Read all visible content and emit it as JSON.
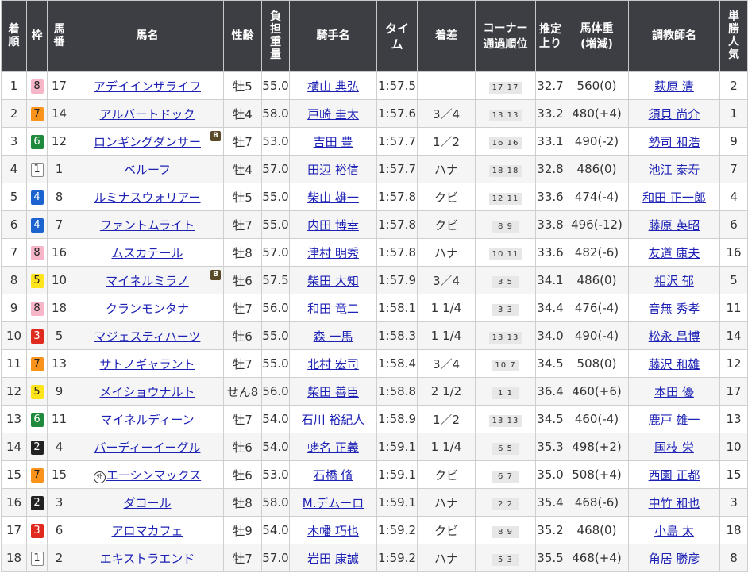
{
  "headers": {
    "rank": "着順",
    "waku": "枠",
    "umaban": "馬番",
    "horse": "馬名",
    "sexage": "性齢",
    "burden": "負担重量",
    "jockey": "騎手名",
    "time": "タイム",
    "margin": "着差",
    "corner": "コーナー通過順位",
    "agari": "推定上り",
    "weight": "馬体重(増減)",
    "trainer": "調教師名",
    "pop": "単勝人気"
  },
  "blinker_label": "B",
  "local_mark": "外",
  "rows": [
    {
      "rank": "1",
      "waku": "8",
      "umaban": "17",
      "horse": "アデイインザライフ",
      "blinker": false,
      "local": false,
      "sexage": "牡5",
      "burden": "55.0",
      "jockey": "横山 典弘",
      "time": "1:57.5",
      "margin": "",
      "corner": "17 17",
      "agari": "32.7",
      "weight": "560(0)",
      "trainer": "萩原 清",
      "pop": "2"
    },
    {
      "rank": "2",
      "waku": "7",
      "umaban": "14",
      "horse": "アルバートドック",
      "blinker": false,
      "local": false,
      "sexage": "牡4",
      "burden": "58.0",
      "jockey": "戸崎 圭太",
      "time": "1:57.6",
      "margin": "3／4",
      "corner": "13 13",
      "agari": "33.2",
      "weight": "480(+4)",
      "trainer": "須貝 尚介",
      "pop": "1"
    },
    {
      "rank": "3",
      "waku": "6",
      "umaban": "12",
      "horse": "ロンギングダンサー",
      "blinker": true,
      "local": false,
      "sexage": "牡7",
      "burden": "53.0",
      "jockey": "吉田 豊",
      "time": "1:57.7",
      "margin": "1／2",
      "corner": "16 16",
      "agari": "33.1",
      "weight": "490(-2)",
      "trainer": "勢司 和浩",
      "pop": "9"
    },
    {
      "rank": "4",
      "waku": "1",
      "umaban": "1",
      "horse": "ベルーフ",
      "blinker": false,
      "local": false,
      "sexage": "牡4",
      "burden": "57.0",
      "jockey": "田辺 裕信",
      "time": "1:57.7",
      "margin": "ハナ",
      "corner": "18 18",
      "agari": "32.8",
      "weight": "486(0)",
      "trainer": "池江 泰寿",
      "pop": "7"
    },
    {
      "rank": "5",
      "waku": "4",
      "umaban": "8",
      "horse": "ルミナスウォリアー",
      "blinker": false,
      "local": false,
      "sexage": "牡5",
      "burden": "55.0",
      "jockey": "柴山 雄一",
      "time": "1:57.8",
      "margin": "クビ",
      "corner": "12 11",
      "agari": "33.6",
      "weight": "474(-4)",
      "trainer": "和田 正一郎",
      "pop": "4"
    },
    {
      "rank": "6",
      "waku": "4",
      "umaban": "7",
      "horse": "ファントムライト",
      "blinker": false,
      "local": false,
      "sexage": "牡7",
      "burden": "55.0",
      "jockey": "内田 博幸",
      "time": "1:57.8",
      "margin": "クビ",
      "corner": "8 9",
      "agari": "33.8",
      "weight": "496(-12)",
      "trainer": "藤原 英昭",
      "pop": "6"
    },
    {
      "rank": "7",
      "waku": "8",
      "umaban": "16",
      "horse": "ムスカテール",
      "blinker": false,
      "local": false,
      "sexage": "牡8",
      "burden": "57.0",
      "jockey": "津村 明秀",
      "time": "1:57.8",
      "margin": "ハナ",
      "corner": "10 11",
      "agari": "33.6",
      "weight": "482(-6)",
      "trainer": "友道 康夫",
      "pop": "16"
    },
    {
      "rank": "8",
      "waku": "5",
      "umaban": "10",
      "horse": "マイネルミラノ",
      "blinker": true,
      "local": false,
      "sexage": "牡6",
      "burden": "57.5",
      "jockey": "柴田 大知",
      "time": "1:57.9",
      "margin": "3／4",
      "corner": "3 5",
      "agari": "34.1",
      "weight": "486(0)",
      "trainer": "相沢 郁",
      "pop": "5"
    },
    {
      "rank": "9",
      "waku": "8",
      "umaban": "18",
      "horse": "クランモンタナ",
      "blinker": false,
      "local": false,
      "sexage": "牡7",
      "burden": "56.0",
      "jockey": "和田 竜二",
      "time": "1:58.1",
      "margin": "1 1/4",
      "corner": "3 3",
      "agari": "34.4",
      "weight": "476(-4)",
      "trainer": "音無 秀孝",
      "pop": "11"
    },
    {
      "rank": "10",
      "waku": "3",
      "umaban": "5",
      "horse": "マジェスティハーツ",
      "blinker": false,
      "local": false,
      "sexage": "牡6",
      "burden": "55.0",
      "jockey": "森 一馬",
      "time": "1:58.3",
      "margin": "1 1/4",
      "corner": "13 13",
      "agari": "34.0",
      "weight": "490(-4)",
      "trainer": "松永 昌博",
      "pop": "14"
    },
    {
      "rank": "11",
      "waku": "7",
      "umaban": "13",
      "horse": "サトノギャラント",
      "blinker": false,
      "local": false,
      "sexage": "牡7",
      "burden": "55.0",
      "jockey": "北村 宏司",
      "time": "1:58.4",
      "margin": "3／4",
      "corner": "10 7",
      "agari": "34.5",
      "weight": "508(0)",
      "trainer": "藤沢 和雄",
      "pop": "12"
    },
    {
      "rank": "12",
      "waku": "5",
      "umaban": "9",
      "horse": "メイショウナルト",
      "blinker": false,
      "local": false,
      "sexage": "せん8",
      "burden": "56.0",
      "jockey": "柴田 善臣",
      "time": "1:58.8",
      "margin": "2 1/2",
      "corner": "1 1",
      "agari": "36.4",
      "weight": "460(+6)",
      "trainer": "本田 優",
      "pop": "17"
    },
    {
      "rank": "13",
      "waku": "6",
      "umaban": "11",
      "horse": "マイネルディーン",
      "blinker": false,
      "local": false,
      "sexage": "牡7",
      "burden": "54.0",
      "jockey": "石川 裕紀人",
      "time": "1:58.9",
      "margin": "1／2",
      "corner": "13 13",
      "agari": "34.5",
      "weight": "460(-4)",
      "trainer": "鹿戸 雄一",
      "pop": "13"
    },
    {
      "rank": "14",
      "waku": "2",
      "umaban": "4",
      "horse": "バーディーイーグル",
      "blinker": false,
      "local": false,
      "sexage": "牡6",
      "burden": "54.0",
      "jockey": "蛯名 正義",
      "time": "1:59.1",
      "margin": "1 1/4",
      "corner": "6 5",
      "agari": "35.3",
      "weight": "498(+2)",
      "trainer": "国枝 栄",
      "pop": "10"
    },
    {
      "rank": "15",
      "waku": "7",
      "umaban": "15",
      "horse": "エーシンマックス",
      "blinker": false,
      "local": true,
      "sexage": "牡6",
      "burden": "53.0",
      "jockey": "石橋 脩",
      "time": "1:59.1",
      "margin": "クビ",
      "corner": "6 7",
      "agari": "35.0",
      "weight": "508(+4)",
      "trainer": "西園 正都",
      "pop": "15"
    },
    {
      "rank": "16",
      "waku": "2",
      "umaban": "3",
      "horse": "ダコール",
      "blinker": false,
      "local": false,
      "sexage": "牡8",
      "burden": "58.0",
      "jockey": "M.デムーロ",
      "time": "1:59.1",
      "margin": "ハナ",
      "corner": "2 2",
      "agari": "35.4",
      "weight": "468(-6)",
      "trainer": "中竹 和也",
      "pop": "3"
    },
    {
      "rank": "17",
      "waku": "3",
      "umaban": "6",
      "horse": "アロマカフェ",
      "blinker": false,
      "local": false,
      "sexage": "牡9",
      "burden": "54.0",
      "jockey": "木幡 巧也",
      "time": "1:59.2",
      "margin": "クビ",
      "corner": "8 9",
      "agari": "35.2",
      "weight": "468(0)",
      "trainer": "小島 太",
      "pop": "18"
    },
    {
      "rank": "18",
      "waku": "1",
      "umaban": "2",
      "horse": "エキストラエンド",
      "blinker": false,
      "local": false,
      "sexage": "牡7",
      "burden": "57.0",
      "jockey": "岩田 康誠",
      "time": "1:59.2",
      "margin": "ハナ",
      "corner": "5 3",
      "agari": "35.5",
      "weight": "468(+4)",
      "trainer": "角居 勝彦",
      "pop": "8"
    }
  ]
}
